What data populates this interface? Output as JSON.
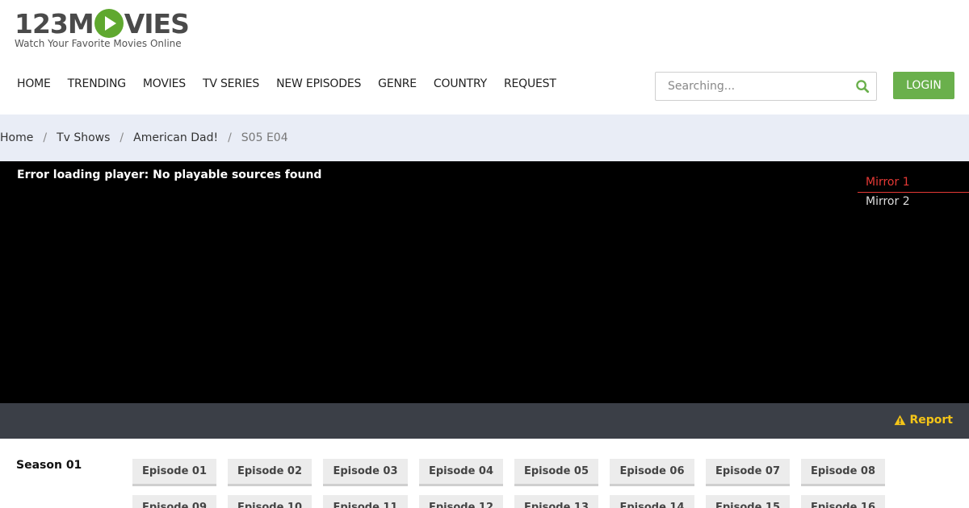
{
  "header": {
    "logo_text_before": "123M",
    "logo_text_after": "VIES",
    "logo_tagline": "Watch Your Favorite Movies Online",
    "nav": [
      "HOME",
      "TRENDING",
      "MOVIES",
      "TV SERIES",
      "NEW EPISODES",
      "GENRE",
      "COUNTRY",
      "REQUEST"
    ],
    "search_placeholder": "Searching...",
    "login_label": "LOGIN"
  },
  "breadcrumb": [
    "Home",
    "Tv Shows",
    "American Dad!",
    "S05 E04"
  ],
  "player": {
    "error": "Error loading player: No playable sources found",
    "mirrors": [
      "Mirror 1",
      "Mirror 2"
    ],
    "report_label": "Report"
  },
  "season": {
    "label": "Season 01",
    "episodes": [
      "Episode 01",
      "Episode 02",
      "Episode 03",
      "Episode 04",
      "Episode 05",
      "Episode 06",
      "Episode 07",
      "Episode 08",
      "Episode 09",
      "Episode 10",
      "Episode 11",
      "Episode 12",
      "Episode 13",
      "Episode 14",
      "Episode 15",
      "Episode 16"
    ]
  },
  "colors": {
    "accent_green": "#6ab04c",
    "active_mirror": "#e53935",
    "report_yellow": "#f5c518"
  }
}
